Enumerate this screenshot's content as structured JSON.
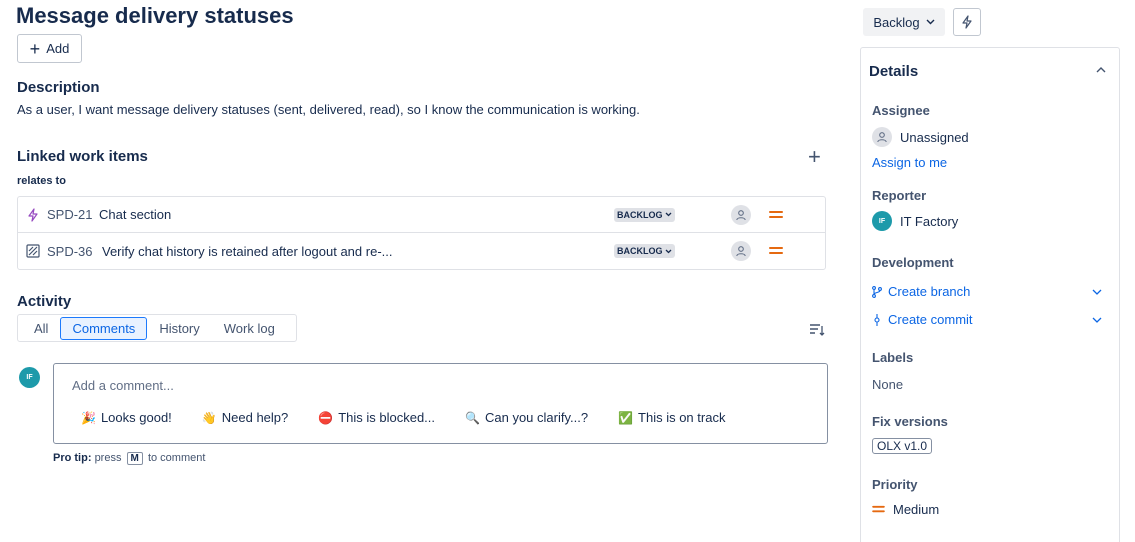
{
  "issue": {
    "title": "Message delivery statuses",
    "add_label": "Add"
  },
  "description": {
    "heading": "Description",
    "text": "As a user, I want message delivery statuses (sent, delivered, read), so I know the communication is working."
  },
  "linked": {
    "heading": "Linked work items",
    "relation": "relates to",
    "items": [
      {
        "key": "SPD-21",
        "summary": "Chat section",
        "status": "BACKLOG",
        "icon": "bolt-epic-icon"
      },
      {
        "key": "SPD-36",
        "summary": "Verify chat history is retained after logout and re-...",
        "status": "BACKLOG",
        "icon": "test-task-icon"
      }
    ]
  },
  "activity": {
    "heading": "Activity",
    "tabs": [
      "All",
      "Comments",
      "History",
      "Work log"
    ],
    "active_tab": "Comments",
    "avatar_initials": "IF",
    "comment_placeholder": "Add a comment...",
    "quick_replies": [
      {
        "emoji": "🎉",
        "label": "Looks good!"
      },
      {
        "emoji": "👋",
        "label": "Need help?"
      },
      {
        "emoji": "⛔",
        "label": "This is blocked..."
      },
      {
        "emoji": "🔍",
        "label": "Can you clarify...?"
      },
      {
        "emoji": "✅",
        "label": "This is on track"
      }
    ],
    "pro_tip_label": "Pro tip:",
    "pro_tip_press": "press",
    "pro_tip_key": "M",
    "pro_tip_suffix": "to comment"
  },
  "sidebar": {
    "status": "Backlog",
    "details_title": "Details",
    "assignee_label": "Assignee",
    "assignee_value": "Unassigned",
    "assign_to_me": "Assign to me",
    "reporter_label": "Reporter",
    "reporter_initials": "IF",
    "reporter_value": "IT Factory",
    "development_label": "Development",
    "create_branch": "Create branch",
    "create_commit": "Create commit",
    "labels_label": "Labels",
    "labels_value": "None",
    "fix_versions_label": "Fix versions",
    "fix_version": "OLX v1.0",
    "priority_label": "Priority",
    "priority_value": "Medium"
  },
  "colors": {
    "accent": "#0c66e4",
    "priority_medium": "#e56910",
    "avatar_teal": "#1d9aaa"
  }
}
